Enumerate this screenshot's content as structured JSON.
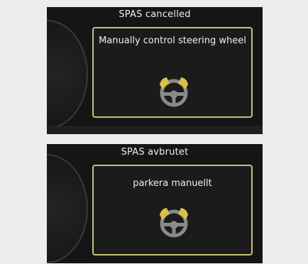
{
  "panels": [
    {
      "title": "SPAS cancelled",
      "message": "Manually control steering wheel",
      "icon": "steering-wheel-icon"
    },
    {
      "title": "SPAS avbrutet",
      "message": "parkera manuellt",
      "icon": "steering-wheel-icon"
    }
  ],
  "colors": {
    "background": "#ececec",
    "screen": "#151515",
    "frame": "#c9c07a",
    "wheel_grip": "#d9c14a",
    "wheel_body": "#8a8a8a",
    "text": "#f0f0f0"
  }
}
